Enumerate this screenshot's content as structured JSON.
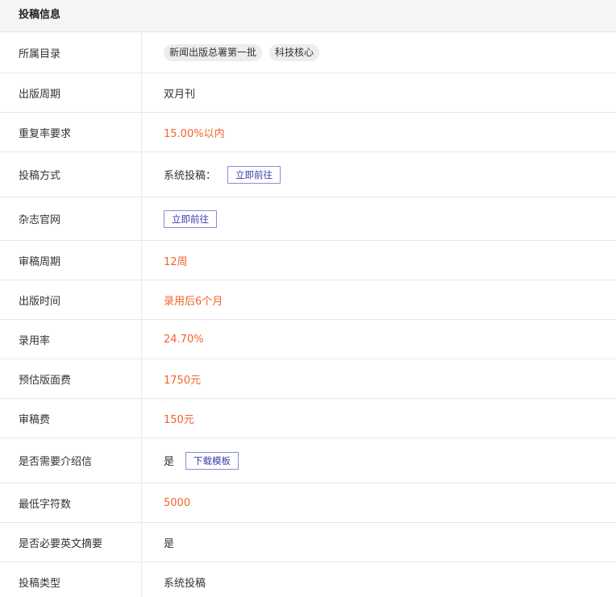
{
  "header": {
    "title": "投稿信息"
  },
  "rows": {
    "catalog": {
      "label": "所属目录",
      "tags": [
        "新闻出版总署第一批",
        "科技核心"
      ]
    },
    "cycle": {
      "label": "出版周期",
      "value": "双月刊"
    },
    "repeat_rate": {
      "label": "重复率要求",
      "value": "15.00%以内"
    },
    "submit_method": {
      "label": "投稿方式",
      "prefix": "系统投稿：",
      "button": "立即前往"
    },
    "website": {
      "label": "杂志官网",
      "button": "立即前往"
    },
    "review_cycle": {
      "label": "审稿周期",
      "value": "12周"
    },
    "publish_time": {
      "label": "出版时间",
      "value": "录用后6个月"
    },
    "accept_rate": {
      "label": "录用率",
      "value": "24.70%"
    },
    "page_fee": {
      "label": "预估版面费",
      "value": "1750元"
    },
    "review_fee": {
      "label": "审稿费",
      "value": "150元"
    },
    "intro_letter": {
      "label": "是否需要介绍信",
      "prefix": "是",
      "button": "下载模板"
    },
    "min_chars": {
      "label": "最低字符数",
      "value": "5000"
    },
    "english_abstract": {
      "label": "是否必要英文摘要",
      "value": "是"
    },
    "submit_type": {
      "label": "投稿类型",
      "value": "系统投稿"
    }
  },
  "colors": {
    "accent_orange": "#f4622c",
    "button_border": "#8a8ad6",
    "button_text": "#3a3ab0"
  }
}
